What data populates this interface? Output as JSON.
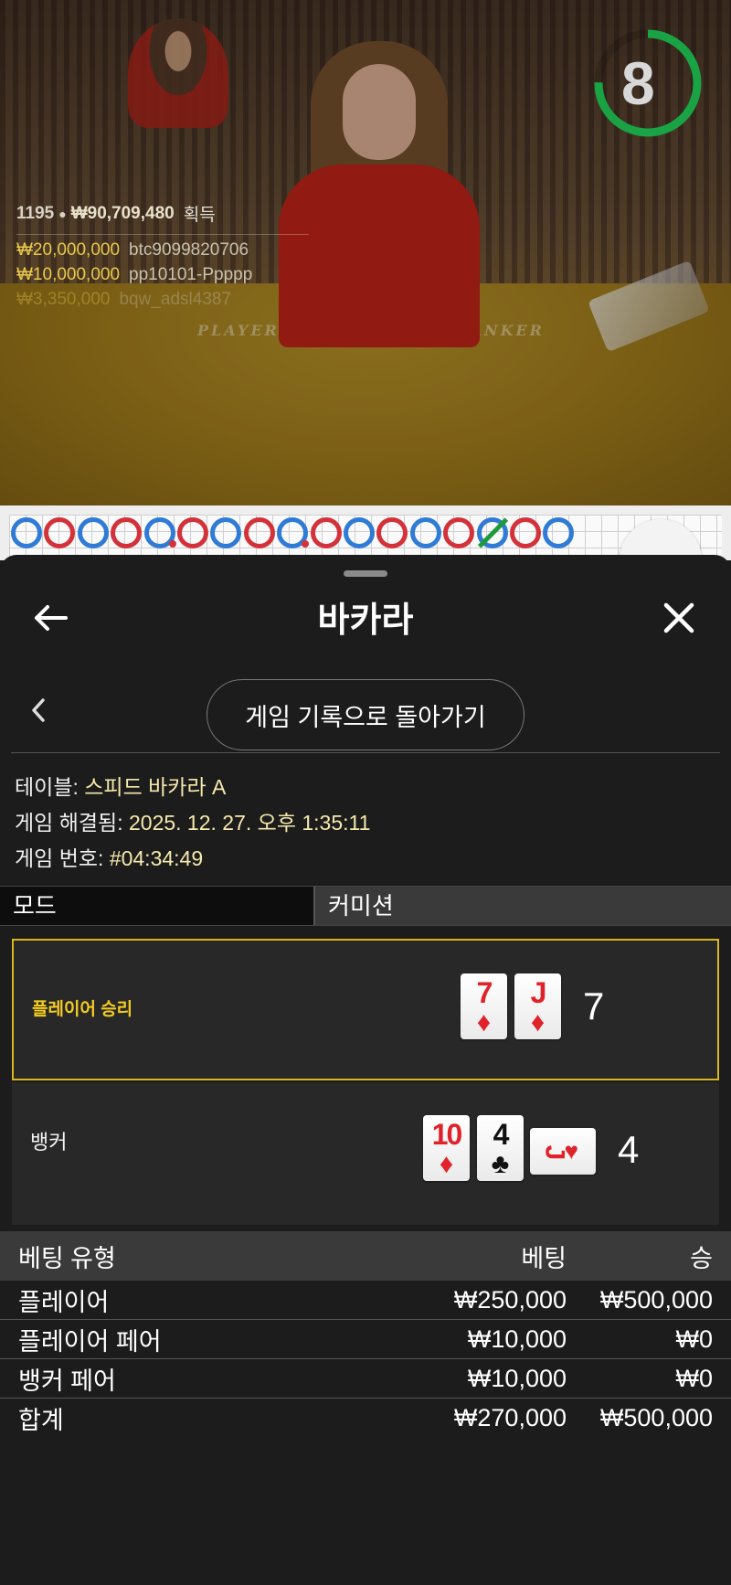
{
  "live": {
    "timer": "8",
    "winners_count": "1195",
    "winners_total": "₩90,709,480",
    "winners_label": "획득",
    "winners": [
      {
        "amount": "₩20,000,000",
        "user": "btc9099820706"
      },
      {
        "amount": "₩10,000,000",
        "user": "pp10101-Ppppp"
      },
      {
        "amount": "₩3,350,000",
        "user": "bqw_adsl4387"
      }
    ],
    "table_labels": [
      "PLAYER",
      "BANKER"
    ]
  },
  "road": [
    {
      "type": "P"
    },
    {
      "type": "B"
    },
    {
      "type": "P"
    },
    {
      "type": "B"
    },
    {
      "type": "P",
      "mark": "B"
    },
    {
      "type": "B"
    },
    {
      "type": "P"
    },
    {
      "type": "B"
    },
    {
      "type": "P",
      "mark": "B"
    },
    {
      "type": "B"
    },
    {
      "type": "P"
    },
    {
      "type": "B"
    },
    {
      "type": "P"
    },
    {
      "type": "B"
    },
    {
      "type": "T"
    },
    {
      "type": "B"
    },
    {
      "type": "P"
    }
  ],
  "sheet": {
    "title": "바카라",
    "history_button": "게임 기록으로 돌아가기",
    "info": {
      "table_key": "테이블:",
      "table_value": "스피드 바카라 A",
      "resolved_key": "게임 해결됨:",
      "resolved_value": "2025. 12. 27. 오후 1:35:11",
      "game_key": "게임 번호:",
      "game_value": "#04:34:49"
    },
    "mode_label": "모드",
    "mode_value": "커미션",
    "player": {
      "label": "플레이어 승리",
      "score": "7",
      "cards": [
        {
          "rank": "7",
          "suit": "♦",
          "color": "red"
        },
        {
          "rank": "J",
          "suit": "♦",
          "color": "red"
        }
      ]
    },
    "banker": {
      "label": "뱅커",
      "score": "4",
      "cards": [
        {
          "rank": "10",
          "suit": "♦",
          "color": "red"
        },
        {
          "rank": "4",
          "suit": "♣",
          "color": "black"
        },
        {
          "rank": "J",
          "suit": "♥",
          "color": "red",
          "sideways": true
        }
      ]
    },
    "bets": {
      "headers": [
        "베팅 유형",
        "베팅",
        "승"
      ],
      "rows": [
        {
          "type": "플레이어",
          "bet": "₩250,000",
          "win": "₩500,000"
        },
        {
          "type": "플레이어 페어",
          "bet": "₩10,000",
          "win": "₩0"
        },
        {
          "type": "뱅커 페어",
          "bet": "₩10,000",
          "win": "₩0"
        }
      ],
      "total": {
        "type": "합계",
        "bet": "₩270,000",
        "win": "₩500,000"
      }
    }
  },
  "colors": {
    "accent_gold": "#d9b61e",
    "player_blue": "#2f7bd6",
    "banker_red": "#d3323b",
    "tie_green": "#1f9a3a",
    "timer_green": "#19a345"
  }
}
